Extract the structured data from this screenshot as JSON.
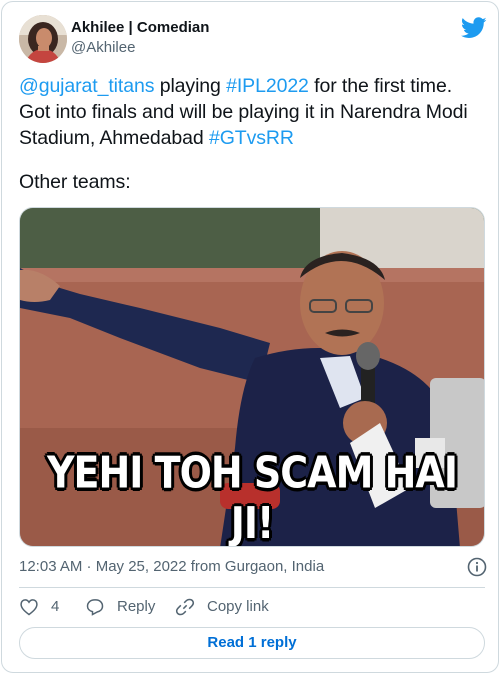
{
  "colors": {
    "link": "#1d9bf0",
    "twitter_blue": "#1d9bf0",
    "secondary_text": "#536471",
    "border": "#cfd9de",
    "read_reply": "#006fd6"
  },
  "author": {
    "display_name": "Akhilee | Comedian",
    "handle": "@Akhilee",
    "avatar_icon": "profile-photo"
  },
  "tweet": {
    "line1_mention": "@gujarat_titans",
    "line1_mid": " playing ",
    "line1_hashtag": "#IPL2022",
    "line1_end": " for the first time.",
    "line2": "Got into finals and will be playing it in  Narendra Modi Stadium, Ahmedabad ",
    "line2_hashtag": "#GTvsRR",
    "line3": "Other teams:"
  },
  "media": {
    "meme_caption": "YEHI TOH SCAM HAI JI!"
  },
  "meta": {
    "timestamp": "12:03 AM · May 25, 2022 from Gurgaon, India"
  },
  "actions": {
    "like_count": "4",
    "reply_label": "Reply",
    "copy_link_label": "Copy link"
  },
  "read_replies_label": "Read 1 reply"
}
